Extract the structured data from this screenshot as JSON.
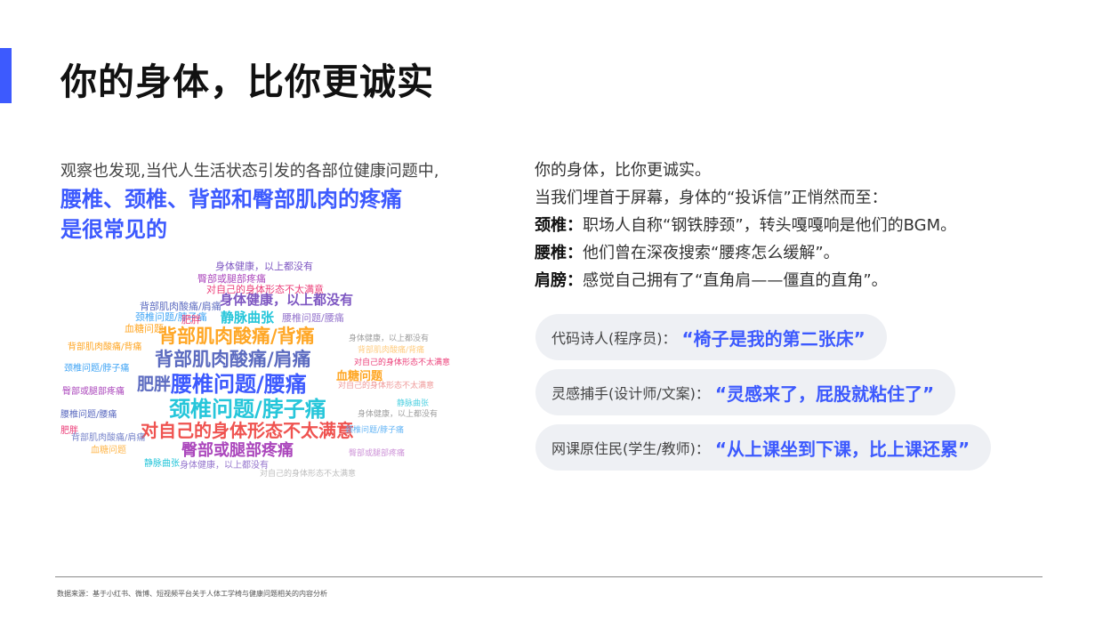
{
  "title": "你的身体，比你更诚实",
  "left": {
    "intro": "观察也发现,当代人生活状态引发的各部位健康问题中,",
    "highlight_line1": "腰椎、颈椎、背部和臀部肌肉的疼痛",
    "highlight_line2": "是很常见的"
  },
  "wordcloud": {
    "words": [
      {
        "text": "身体健康，以上都没有",
        "color": "#7e57c2"
      },
      {
        "text": "臀部或腿部疼痛",
        "color": "#ab47bc"
      },
      {
        "text": "对自己的身体形态不太满意",
        "color": "#ec407a"
      },
      {
        "text": "身体健康，以上都没有",
        "color": "#7e57c2"
      },
      {
        "text": "背部肌肉酸痛/肩痛",
        "color": "#5c6bc0"
      },
      {
        "text": "颈椎问题/脖子痛",
        "color": "#42a5f5"
      },
      {
        "text": "肥胖",
        "color": "#ec407a"
      },
      {
        "text": "静脉曲张",
        "color": "#26c6da"
      },
      {
        "text": "腰椎问题/腰痛",
        "color": "#9575cd"
      },
      {
        "text": "血糖问题",
        "color": "#ffa726"
      },
      {
        "text": "背部肌肉酸痛/背痛",
        "color": "#ffa726"
      },
      {
        "text": "身体健康，以上都没有",
        "color": "#9e9e9e"
      },
      {
        "text": "背部肌肉酸痛/肩痛",
        "color": "#5c6bc0"
      },
      {
        "text": "对自己的身体形态不太满意",
        "color": "#ec407a"
      },
      {
        "text": "肥胖",
        "color": "#5c6bc0"
      },
      {
        "text": "腰椎问题/腰痛",
        "color": "#3d5afe"
      },
      {
        "text": "血糖问题",
        "color": "#ffa726"
      },
      {
        "text": "颈椎问题/脖子痛",
        "color": "#26c6da"
      },
      {
        "text": "对自己的身体形态不太满意",
        "color": "#ef5350"
      },
      {
        "text": "臀部或腿部疼痛",
        "color": "#ab47bc"
      },
      {
        "text": "身体健康，以上都没有",
        "color": "#9575cd"
      },
      {
        "text": "静脉曲张",
        "color": "#26c6da"
      },
      {
        "text": "对自己的身体形态不太满意",
        "color": "#bdbdbd"
      },
      {
        "text": "背部肌肉酸痛/背痛",
        "color": "#ffa726"
      },
      {
        "text": "颈椎问题/脖子痛",
        "color": "#42a5f5"
      },
      {
        "text": "臀部或腿部疼痛",
        "color": "#ab47bc"
      },
      {
        "text": "腰椎问题/腰痛",
        "color": "#5c6bc0"
      },
      {
        "text": "背部肌肉酸痛/肩痛",
        "color": "#7986cb"
      },
      {
        "text": "肥胖",
        "color": "#ec407a"
      },
      {
        "text": "血糖问题",
        "color": "#ffb74d"
      },
      {
        "text": "身体健康，以上都没有",
        "color": "#9e9e9e"
      },
      {
        "text": "对自己的身体形态不太满意",
        "color": "#ef9a9a"
      },
      {
        "text": "静脉曲张",
        "color": "#4dd0e1"
      },
      {
        "text": "颈椎问题/脖子痛",
        "color": "#64b5f6"
      },
      {
        "text": "臀部或腿部疼痛",
        "color": "#ce93d8"
      },
      {
        "text": "背部肌肉酸痛/背痛",
        "color": "#ffcc80"
      }
    ]
  },
  "right": {
    "line1": "你的身体，比你更诚实。",
    "line2": "当我们埋首于屏幕，身体的“投诉信”正悄然而至：",
    "items": [
      {
        "label": "颈椎：",
        "text": "职场人自称“钢铁脖颈”，转头嘎嘎响是他们的BGM。"
      },
      {
        "label": "腰椎：",
        "text": "他们曾在深夜搜索“腰疼怎么缓解”。"
      },
      {
        "label": "肩膀：",
        "text": "感觉自己拥有了“直角肩——僵直的直角”。"
      }
    ]
  },
  "pills": [
    {
      "role": "代码诗人(程序员)：",
      "quote": "“椅子是我的第二张床”"
    },
    {
      "role": "灵感捕手(设计师/文案)：",
      "quote": "“灵感来了，屁股就粘住了”"
    },
    {
      "role": "网课原住民(学生/教师)：",
      "quote": "“从上课坐到下课，比上课还累”"
    }
  ],
  "footer": {
    "source": "数据来源：基于小红书、微博、短视频平台关于人体工学椅与健康问题相关的内容分析"
  },
  "colors": {
    "accent": "#3D5AFE",
    "pill_bg": "#eef0f4"
  }
}
